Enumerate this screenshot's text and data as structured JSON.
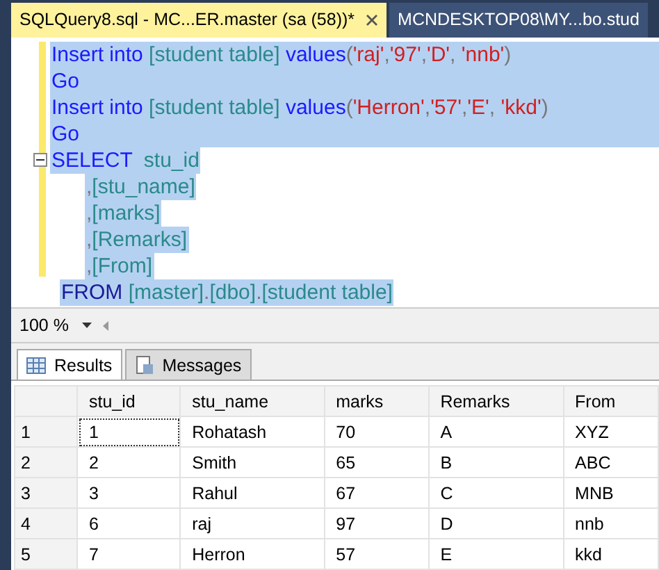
{
  "document_tabs": [
    {
      "label": "SQLQuery8.sql - MC...ER.master (sa (58))*",
      "selected": true
    },
    {
      "label": "MCNDESKTOP08\\MY...bo.stud",
      "selected": false
    }
  ],
  "editor": {
    "lines": [
      {
        "kind": "statement",
        "selected": true,
        "selection_to_edge": true,
        "foldable": false,
        "tokens": [
          {
            "kind": "keyword",
            "text": "Insert into "
          },
          {
            "kind": "identifier",
            "text": "[student table] "
          },
          {
            "kind": "keyword",
            "text": "values"
          },
          {
            "kind": "punct",
            "text": "("
          },
          {
            "kind": "string",
            "text": "'raj'"
          },
          {
            "kind": "punct",
            "text": ","
          },
          {
            "kind": "string",
            "text": "'97'"
          },
          {
            "kind": "punct",
            "text": ","
          },
          {
            "kind": "string",
            "text": "'D'"
          },
          {
            "kind": "punct",
            "text": ", "
          },
          {
            "kind": "string",
            "text": "'nnb'"
          },
          {
            "kind": "punct",
            "text": ")"
          }
        ]
      },
      {
        "kind": "statement",
        "selected": true,
        "selection_to_edge": true,
        "foldable": false,
        "tokens": [
          {
            "kind": "keyword",
            "text": "Go"
          }
        ]
      },
      {
        "kind": "statement",
        "selected": true,
        "selection_to_edge": true,
        "foldable": false,
        "tokens": [
          {
            "kind": "keyword",
            "text": "Insert into "
          },
          {
            "kind": "identifier",
            "text": "[student table] "
          },
          {
            "kind": "keyword",
            "text": "values"
          },
          {
            "kind": "punct",
            "text": "("
          },
          {
            "kind": "string",
            "text": "'Herron'"
          },
          {
            "kind": "punct",
            "text": ","
          },
          {
            "kind": "string",
            "text": "'57'"
          },
          {
            "kind": "punct",
            "text": ","
          },
          {
            "kind": "string",
            "text": "'E'"
          },
          {
            "kind": "punct",
            "text": ", "
          },
          {
            "kind": "string",
            "text": "'kkd'"
          },
          {
            "kind": "punct",
            "text": ")"
          }
        ]
      },
      {
        "kind": "statement",
        "selected": true,
        "selection_to_edge": true,
        "foldable": false,
        "tokens": [
          {
            "kind": "keyword",
            "text": "Go"
          }
        ]
      },
      {
        "kind": "statement",
        "selected": true,
        "selection_to_edge": false,
        "foldable": true,
        "tokens": [
          {
            "kind": "keyword",
            "text": "SELECT  "
          },
          {
            "kind": "identifier",
            "text": "stu_id"
          }
        ]
      },
      {
        "kind": "column",
        "selected": true,
        "selection_to_edge": false,
        "foldable": false,
        "tokens": [
          {
            "kind": "punct",
            "text": ","
          },
          {
            "kind": "identifier",
            "text": "[stu_name]"
          }
        ]
      },
      {
        "kind": "column",
        "selected": true,
        "selection_to_edge": false,
        "foldable": false,
        "tokens": [
          {
            "kind": "punct",
            "text": ","
          },
          {
            "kind": "identifier",
            "text": "[marks]"
          }
        ]
      },
      {
        "kind": "column",
        "selected": true,
        "selection_to_edge": false,
        "foldable": false,
        "tokens": [
          {
            "kind": "punct",
            "text": ","
          },
          {
            "kind": "identifier",
            "text": "[Remarks]"
          }
        ]
      },
      {
        "kind": "column",
        "selected": true,
        "selection_to_edge": false,
        "foldable": false,
        "tokens": [
          {
            "kind": "punct",
            "text": ","
          },
          {
            "kind": "identifier",
            "text": "[From]"
          }
        ]
      },
      {
        "kind": "clause",
        "selected": true,
        "selection_to_edge": false,
        "foldable": false,
        "tokens": [
          {
            "kind": "keyword2",
            "text": "FROM "
          },
          {
            "kind": "identifier",
            "text": "[master]"
          },
          {
            "kind": "punct",
            "text": "."
          },
          {
            "kind": "identifier",
            "text": "[dbo]"
          },
          {
            "kind": "punct",
            "text": "."
          },
          {
            "kind": "identifier",
            "text": "[student table]"
          }
        ]
      }
    ]
  },
  "zoom": {
    "value": "100 %"
  },
  "result_tabs": [
    {
      "label": "Results",
      "selected": true
    },
    {
      "label": "Messages",
      "selected": false
    }
  ],
  "grid": {
    "columns": [
      "stu_id",
      "stu_name",
      "marks",
      "Remarks",
      "From"
    ],
    "rows": [
      {
        "number": "1",
        "focused": true,
        "cells": [
          "1",
          "Rohatash",
          "70",
          "A",
          "XYZ"
        ]
      },
      {
        "number": "2",
        "focused": false,
        "cells": [
          "2",
          "Smith",
          "65",
          "B",
          "ABC"
        ]
      },
      {
        "number": "3",
        "focused": false,
        "cells": [
          "3",
          "Rahul",
          "67",
          "C",
          "MNB"
        ]
      },
      {
        "number": "4",
        "focused": false,
        "cells": [
          "6",
          "raj",
          "97",
          "D",
          "nnb"
        ]
      },
      {
        "number": "5",
        "focused": false,
        "cells": [
          "7",
          "Herron",
          "57",
          "E",
          "kkd"
        ]
      }
    ]
  }
}
